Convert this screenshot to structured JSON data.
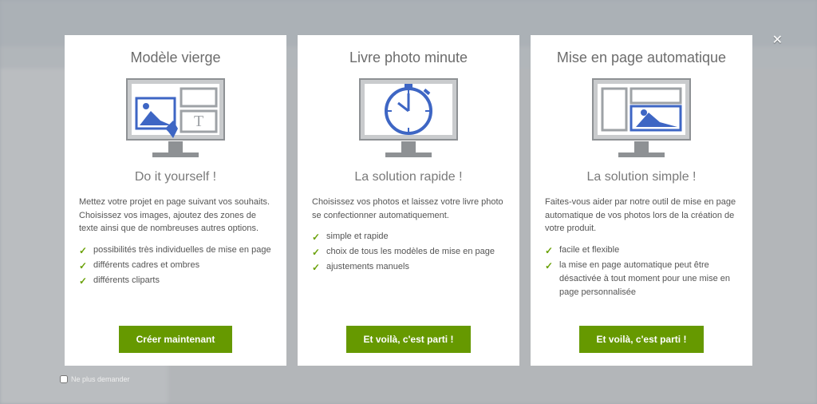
{
  "dialog": {
    "close_label": "✕",
    "dont_ask_label": "Ne plus demander"
  },
  "cards": [
    {
      "title": "Modèle vierge",
      "subtitle": "Do it yourself !",
      "description": "Mettez votre projet en page suivant vos souhaits. Choisissez vos images, ajoutez des zones de texte ainsi que de nombreuses autres options.",
      "benefits": [
        "possibilités très individuelles de mise en page",
        "différents cadres et ombres",
        "différents cliparts"
      ],
      "cta": "Créer maintenant"
    },
    {
      "title": "Livre photo minute",
      "subtitle": "La solution rapide !",
      "description": "Choisissez vos photos et laissez votre livre photo se confectionner automatiquement.",
      "benefits": [
        "simple et rapide",
        "choix de tous les modèles de mise en page",
        "ajustements manuels"
      ],
      "cta": "Et voilà, c'est parti !"
    },
    {
      "title": "Mise en page automatique",
      "subtitle": "La solution simple !",
      "description": "Faites-vous aider par notre outil de mise en page automatique de vos photos lors de la création de votre produit.",
      "benefits": [
        "facile et flexible",
        "la mise en page automatique peut être désactivée à tout moment pour une mise en page personnalisée"
      ],
      "cta": "Et voilà, c'est parti !"
    }
  ],
  "icons": {
    "card0": "blank-template",
    "card1": "stopwatch",
    "card2": "auto-layout"
  }
}
